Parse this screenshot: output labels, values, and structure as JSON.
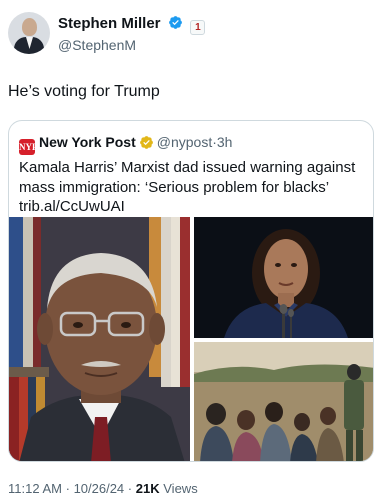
{
  "author": {
    "display_name": "Stephen Miller",
    "handle": "@StephenM",
    "avatar_icon": "avatar-photo-icon",
    "verified_icon": "blue-verified-badge-icon",
    "affiliation_badge": "1",
    "verified_color": "#1d9bf0"
  },
  "tweet": {
    "text": "He’s voting for Trump"
  },
  "quote": {
    "account_name": "New York Post",
    "handle": "@nypost",
    "separator": "·",
    "time_ago": "3h",
    "logo_text": "NYP",
    "text_line1": "Kamala Harris’ Marxist dad issued warning against",
    "text_line2": "mass immigration: ‘Serious problem for blacks’",
    "link": "trib.al/CcUwUAI",
    "verified_icon": "gold-verified-badge-icon",
    "brand_color": "#d6202b",
    "media": [
      {
        "icon": "older-man-glasses-photo"
      },
      {
        "icon": "woman-speaking-at-podium-photo"
      },
      {
        "icon": "migrants-at-border-photo"
      }
    ]
  },
  "meta": {
    "time": "11:12 AM",
    "date": "10/26/24",
    "separator": "·",
    "views_count": "21K",
    "views_label": "Views"
  }
}
